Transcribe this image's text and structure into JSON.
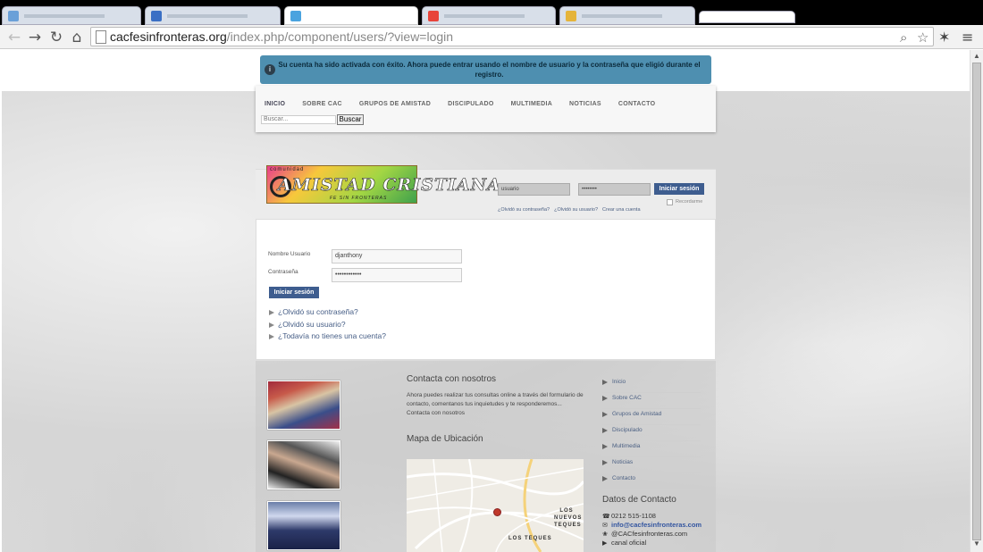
{
  "browser": {
    "url_host": "cacfesinfronteras.org",
    "url_path": "/index.php/component/users/?view=login",
    "icons": {
      "back": "arrow-left",
      "forward": "arrow-right",
      "reload": "reload",
      "home": "home",
      "zoom": "magnifier",
      "star": "star",
      "extension": "puzzle",
      "menu": "hamburger"
    },
    "tab_favicon_colors": [
      "#6aa0d8",
      "#3a6fc4",
      "#4aa3df",
      "#e8443a",
      "#e5b43a"
    ]
  },
  "alert": {
    "icon": "info-icon",
    "message": "Su cuenta ha sido activada con éxito. Ahora puede entrar usando el nombre de usuario y la contraseña que eligió durante el registro.",
    "color": "#4e8fb0"
  },
  "menu": [
    "INICIO",
    "SOBRE CAC",
    "GRUPOS DE AMISTAD",
    "DISCIPULADO",
    "MULTIMEDIA",
    "NOTICIAS",
    "CONTACTO"
  ],
  "search": {
    "placeholder": "Buscar...",
    "button": "Buscar"
  },
  "logo": {
    "small": "comunidad",
    "big": "AMISTAD CRISTIANA",
    "tagline": "FE SIN FRONTERAS"
  },
  "header_login": {
    "user_placeholder": "usuario",
    "pass_value": "••••••••",
    "button": "Iniciar sesión",
    "links": [
      "¿Olvidó su contraseña?",
      "¿Olvidó su usuario?",
      "Crear una cuenta"
    ],
    "remember": "Recordarme"
  },
  "login_form": {
    "user_label": "Nombre Usuario",
    "user_value": "djanthony",
    "pass_label": "Contraseña",
    "pass_value": "••••••••••••",
    "button": "Iniciar sesión",
    "links": [
      "¿Olvidó su contraseña?",
      "¿Olvidó su usuario?",
      "¿Todavía no tienes una cuenta?"
    ]
  },
  "footer": {
    "contact_title": "Contacta con nosotros",
    "contact_text": "Ahora puedes realizar tus consultas online a través del formulario de contacto, comentanos tus inquietudes y te responderemos... Contacta con nosotros",
    "map_title": "Mapa de Ubicación",
    "map_labels": [
      "LOS NUEVOS TEQUES",
      "LOS TEQUES"
    ],
    "nav": [
      "Inicio",
      "Sobre CAC",
      "Grupos de Amistad",
      "Discipulado",
      "Multimedia",
      "Noticias",
      "Contacto"
    ],
    "data_title": "Datos de Contacto",
    "phone": "0212 515-1108",
    "email": "info@cacfesinfronteras.com",
    "twitter": "@CACfesinfronteras.com",
    "channel": "canal oficial"
  }
}
